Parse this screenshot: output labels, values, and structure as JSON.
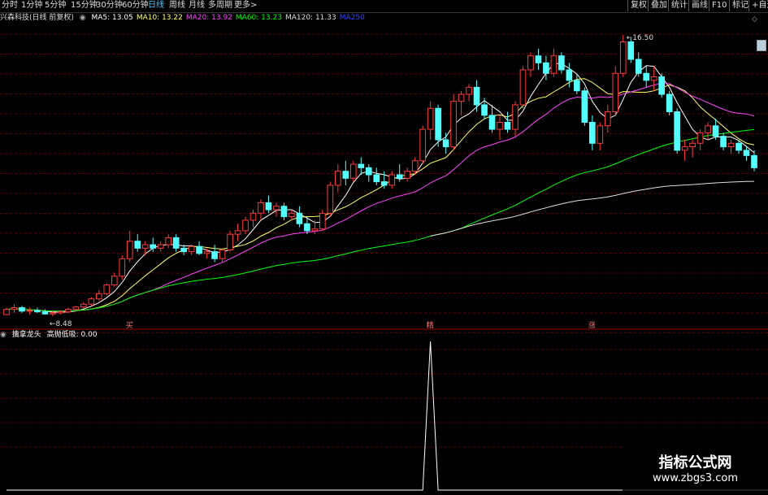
{
  "window": {
    "stock_title": "兴森科技(日线 前复权)",
    "periods": [
      "分时",
      "1分钟",
      "5分钟",
      "15分钟",
      "30分钟",
      "60分钟",
      "日线",
      "周线",
      "月线",
      "多周期",
      "更多>"
    ],
    "active_period": "日线",
    "tools": [
      "复权",
      "叠加",
      "统计",
      "画线",
      "F10",
      "标记",
      "+自选"
    ]
  },
  "ma": [
    {
      "label": "MA5: 13.05",
      "color": "#ffffff"
    },
    {
      "label": "MA10: 13.22",
      "color": "#ffff66"
    },
    {
      "label": "MA20: 13.92",
      "color": "#ff44ff"
    },
    {
      "label": "MA60: 13.23",
      "color": "#00ff00"
    },
    {
      "label": "MA120: 11.33",
      "color": "#dddddd"
    },
    {
      "label": "MA250",
      "color": "#3344ff"
    }
  ],
  "annotations": {
    "high": "16.50",
    "low": "8.48",
    "markers": [
      "买",
      "精",
      "涨"
    ]
  },
  "indicator": {
    "name": "擒拿龙头",
    "reading": "高抛低吸: 0.00"
  },
  "watermark": {
    "title": "指标公式网",
    "url": "www.zbgs3.com"
  },
  "colors": {
    "up": "#ff3b3b",
    "down": "#54ffff",
    "grid": "#5a0000"
  },
  "chart_data": {
    "type": "candlestick",
    "candles": [
      [
        8.5,
        8.7,
        8.48,
        8.65
      ],
      [
        8.65,
        8.8,
        8.55,
        8.7
      ],
      [
        8.7,
        8.75,
        8.55,
        8.6
      ],
      [
        8.6,
        8.7,
        8.5,
        8.62
      ],
      [
        8.62,
        8.7,
        8.55,
        8.58
      ],
      [
        8.58,
        8.65,
        8.5,
        8.52
      ],
      [
        8.52,
        8.6,
        8.45,
        8.55
      ],
      [
        8.55,
        8.62,
        8.5,
        8.58
      ],
      [
        8.58,
        8.7,
        8.55,
        8.65
      ],
      [
        8.65,
        8.75,
        8.6,
        8.72
      ],
      [
        8.72,
        8.85,
        8.68,
        8.8
      ],
      [
        8.8,
        9.0,
        8.75,
        8.95
      ],
      [
        8.95,
        9.2,
        8.9,
        9.1
      ],
      [
        9.1,
        9.4,
        9.05,
        9.35
      ],
      [
        9.35,
        9.7,
        9.3,
        9.6
      ],
      [
        9.6,
        10.2,
        9.5,
        10.1
      ],
      [
        10.1,
        10.9,
        10.0,
        10.6
      ],
      [
        10.6,
        10.8,
        10.3,
        10.4
      ],
      [
        10.4,
        10.6,
        10.2,
        10.5
      ],
      [
        10.5,
        10.7,
        10.3,
        10.4
      ],
      [
        10.4,
        10.6,
        10.3,
        10.5
      ],
      [
        10.5,
        10.8,
        10.4,
        10.7
      ],
      [
        10.7,
        10.8,
        10.3,
        10.4
      ],
      [
        10.4,
        10.5,
        10.2,
        10.3
      ],
      [
        10.3,
        10.5,
        10.2,
        10.45
      ],
      [
        10.45,
        10.6,
        10.2,
        10.25
      ],
      [
        10.25,
        10.4,
        10.1,
        10.3
      ],
      [
        10.3,
        10.5,
        10.0,
        10.1
      ],
      [
        10.1,
        10.4,
        10.0,
        10.35
      ],
      [
        10.35,
        10.9,
        10.3,
        10.8
      ],
      [
        10.8,
        11.1,
        10.6,
        10.9
      ],
      [
        10.9,
        11.3,
        10.8,
        11.2
      ],
      [
        11.2,
        11.5,
        11.0,
        11.4
      ],
      [
        11.4,
        11.8,
        11.2,
        11.7
      ],
      [
        11.7,
        11.9,
        11.4,
        11.5
      ],
      [
        11.5,
        11.7,
        11.3,
        11.6
      ],
      [
        11.6,
        11.7,
        11.2,
        11.3
      ],
      [
        11.3,
        11.5,
        11.2,
        11.4
      ],
      [
        11.4,
        11.6,
        11.0,
        11.1
      ],
      [
        11.1,
        11.3,
        10.8,
        10.9
      ],
      [
        10.9,
        11.2,
        10.8,
        10.95
      ],
      [
        10.95,
        11.5,
        10.9,
        11.4
      ],
      [
        11.4,
        12.3,
        11.3,
        12.2
      ],
      [
        12.2,
        12.8,
        12.0,
        12.6
      ],
      [
        12.6,
        12.9,
        12.2,
        12.4
      ],
      [
        12.4,
        12.9,
        12.3,
        12.8
      ],
      [
        12.8,
        13.0,
        12.5,
        12.7
      ],
      [
        12.7,
        12.8,
        12.3,
        12.5
      ],
      [
        12.5,
        12.7,
        12.2,
        12.3
      ],
      [
        12.3,
        12.6,
        12.1,
        12.2
      ],
      [
        12.2,
        12.6,
        12.1,
        12.5
      ],
      [
        12.5,
        12.8,
        12.3,
        12.4
      ],
      [
        12.4,
        12.7,
        12.3,
        12.6
      ],
      [
        12.6,
        13.0,
        12.5,
        12.9
      ],
      [
        12.9,
        13.9,
        12.8,
        13.8
      ],
      [
        13.8,
        14.6,
        13.5,
        14.4
      ],
      [
        14.4,
        14.5,
        13.3,
        13.5
      ],
      [
        13.5,
        13.7,
        13.1,
        13.3
      ],
      [
        13.3,
        14.8,
        13.2,
        14.6
      ],
      [
        14.6,
        14.9,
        14.2,
        14.8
      ],
      [
        14.8,
        15.1,
        14.6,
        15.0
      ],
      [
        15.0,
        15.2,
        14.3,
        14.5
      ],
      [
        14.5,
        14.7,
        14.1,
        14.2
      ],
      [
        14.2,
        14.5,
        13.7,
        13.8
      ],
      [
        13.8,
        14.2,
        13.5,
        14.0
      ],
      [
        14.0,
        14.3,
        13.7,
        13.8
      ],
      [
        13.8,
        14.6,
        13.6,
        14.5
      ],
      [
        14.5,
        15.6,
        14.4,
        15.5
      ],
      [
        15.5,
        16.0,
        15.3,
        15.9
      ],
      [
        15.9,
        16.1,
        15.5,
        15.7
      ],
      [
        15.7,
        15.9,
        15.2,
        15.4
      ],
      [
        15.4,
        16.1,
        15.3,
        15.9
      ],
      [
        15.9,
        16.0,
        15.4,
        15.5
      ],
      [
        15.5,
        15.7,
        15.0,
        15.2
      ],
      [
        15.2,
        15.4,
        14.8,
        14.9
      ],
      [
        14.9,
        15.0,
        13.9,
        14.0
      ],
      [
        14.0,
        14.2,
        13.2,
        13.4
      ],
      [
        13.4,
        14.0,
        13.2,
        13.9
      ],
      [
        13.9,
        14.5,
        13.7,
        14.3
      ],
      [
        14.3,
        15.6,
        14.2,
        15.4
      ],
      [
        15.4,
        16.5,
        15.3,
        16.3
      ],
      [
        16.3,
        16.4,
        15.7,
        15.8
      ],
      [
        15.8,
        16.0,
        15.3,
        15.4
      ],
      [
        15.4,
        15.6,
        15.0,
        15.2
      ],
      [
        15.2,
        15.6,
        14.9,
        15.3
      ],
      [
        15.3,
        15.4,
        14.7,
        14.8
      ],
      [
        14.8,
        14.9,
        14.2,
        14.3
      ],
      [
        14.3,
        14.4,
        13.1,
        13.2
      ],
      [
        13.2,
        13.5,
        12.9,
        13.3
      ],
      [
        13.3,
        13.5,
        13.0,
        13.4
      ],
      [
        13.4,
        13.8,
        13.2,
        13.7
      ],
      [
        13.7,
        14.0,
        13.5,
        13.9
      ],
      [
        13.9,
        14.1,
        13.5,
        13.6
      ],
      [
        13.6,
        13.7,
        13.2,
        13.3
      ],
      [
        13.3,
        13.5,
        13.1,
        13.4
      ],
      [
        13.4,
        13.5,
        13.1,
        13.2
      ],
      [
        13.2,
        13.3,
        12.9,
        13.05
      ],
      [
        13.05,
        13.2,
        12.6,
        12.7
      ]
    ],
    "price_range": [
      8.2,
      16.8
    ],
    "indicator_values": [
      0,
      0,
      0,
      0,
      0,
      0,
      0,
      0,
      0,
      0,
      0,
      0,
      0,
      0,
      0,
      0,
      0,
      0,
      0,
      0,
      0,
      0,
      0,
      0,
      0,
      0,
      0,
      0,
      0,
      0,
      0,
      0,
      0,
      0,
      0,
      0,
      0,
      0,
      0,
      0,
      0,
      0,
      0,
      0,
      0,
      0,
      0,
      0,
      0,
      0,
      0,
      0,
      0,
      0,
      0,
      100,
      0,
      0,
      0,
      0,
      0,
      0,
      0,
      0,
      0,
      0,
      0,
      0,
      0,
      0,
      0,
      0,
      0,
      0,
      0,
      0,
      0,
      0,
      0,
      0,
      0,
      0,
      0,
      0,
      0,
      0,
      0,
      0,
      0,
      0,
      0,
      0,
      0,
      0,
      0,
      0,
      0,
      0,
      0,
      0
    ],
    "ma_periods": [
      5,
      10,
      20,
      60,
      120
    ],
    "marker_indices": [
      16,
      55,
      76
    ]
  }
}
